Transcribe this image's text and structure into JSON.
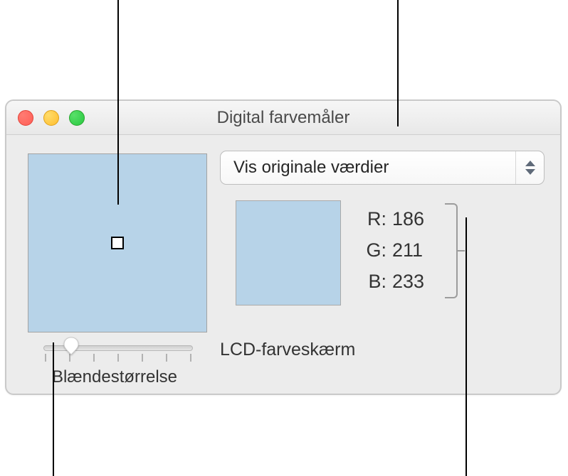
{
  "window": {
    "title": "Digital farvemåler"
  },
  "modeSelect": {
    "selected": "Vis originale værdier"
  },
  "rgb": {
    "r_label": "R:",
    "r_value": "186",
    "g_label": "G:",
    "g_value": "211",
    "b_label": "B:",
    "b_value": "233"
  },
  "displayProfile": "LCD-farveskærm",
  "slider": {
    "label": "Blændestørrelse"
  },
  "colors": {
    "sampled": "#bad3e9"
  }
}
